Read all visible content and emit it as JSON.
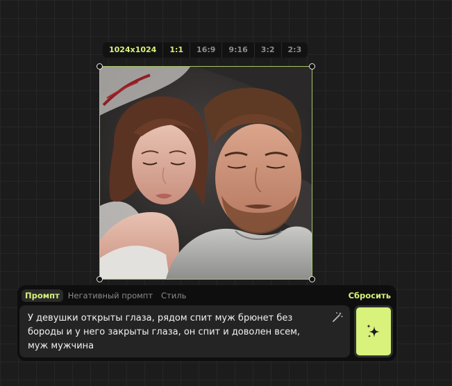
{
  "aspect_ratios": {
    "items": [
      "1024x1024",
      "1:1",
      "16:9",
      "9:16",
      "3:2",
      "2:3"
    ],
    "selected": [
      "1024x1024",
      "1:1"
    ]
  },
  "image": {
    "description_icon": "generated-image"
  },
  "prompt_panel": {
    "tabs": [
      "Промпт",
      "Негативный промпт",
      "Стиль"
    ],
    "active_tab": "Промпт",
    "reset_label": "Сбросить",
    "prompt_text": "У девушки открыты глаза, рядом спит муж брюнет без бороды и у него закрыты глаза, он спит и доволен всем, муж мужчина",
    "magic_icon": "magic-wand-icon",
    "generate_icon": "sparkles-icon"
  },
  "colors": {
    "accent": "#d8f27c",
    "background": "#1c1c1c",
    "panel": "#0e0e0e",
    "input": "#242424"
  }
}
